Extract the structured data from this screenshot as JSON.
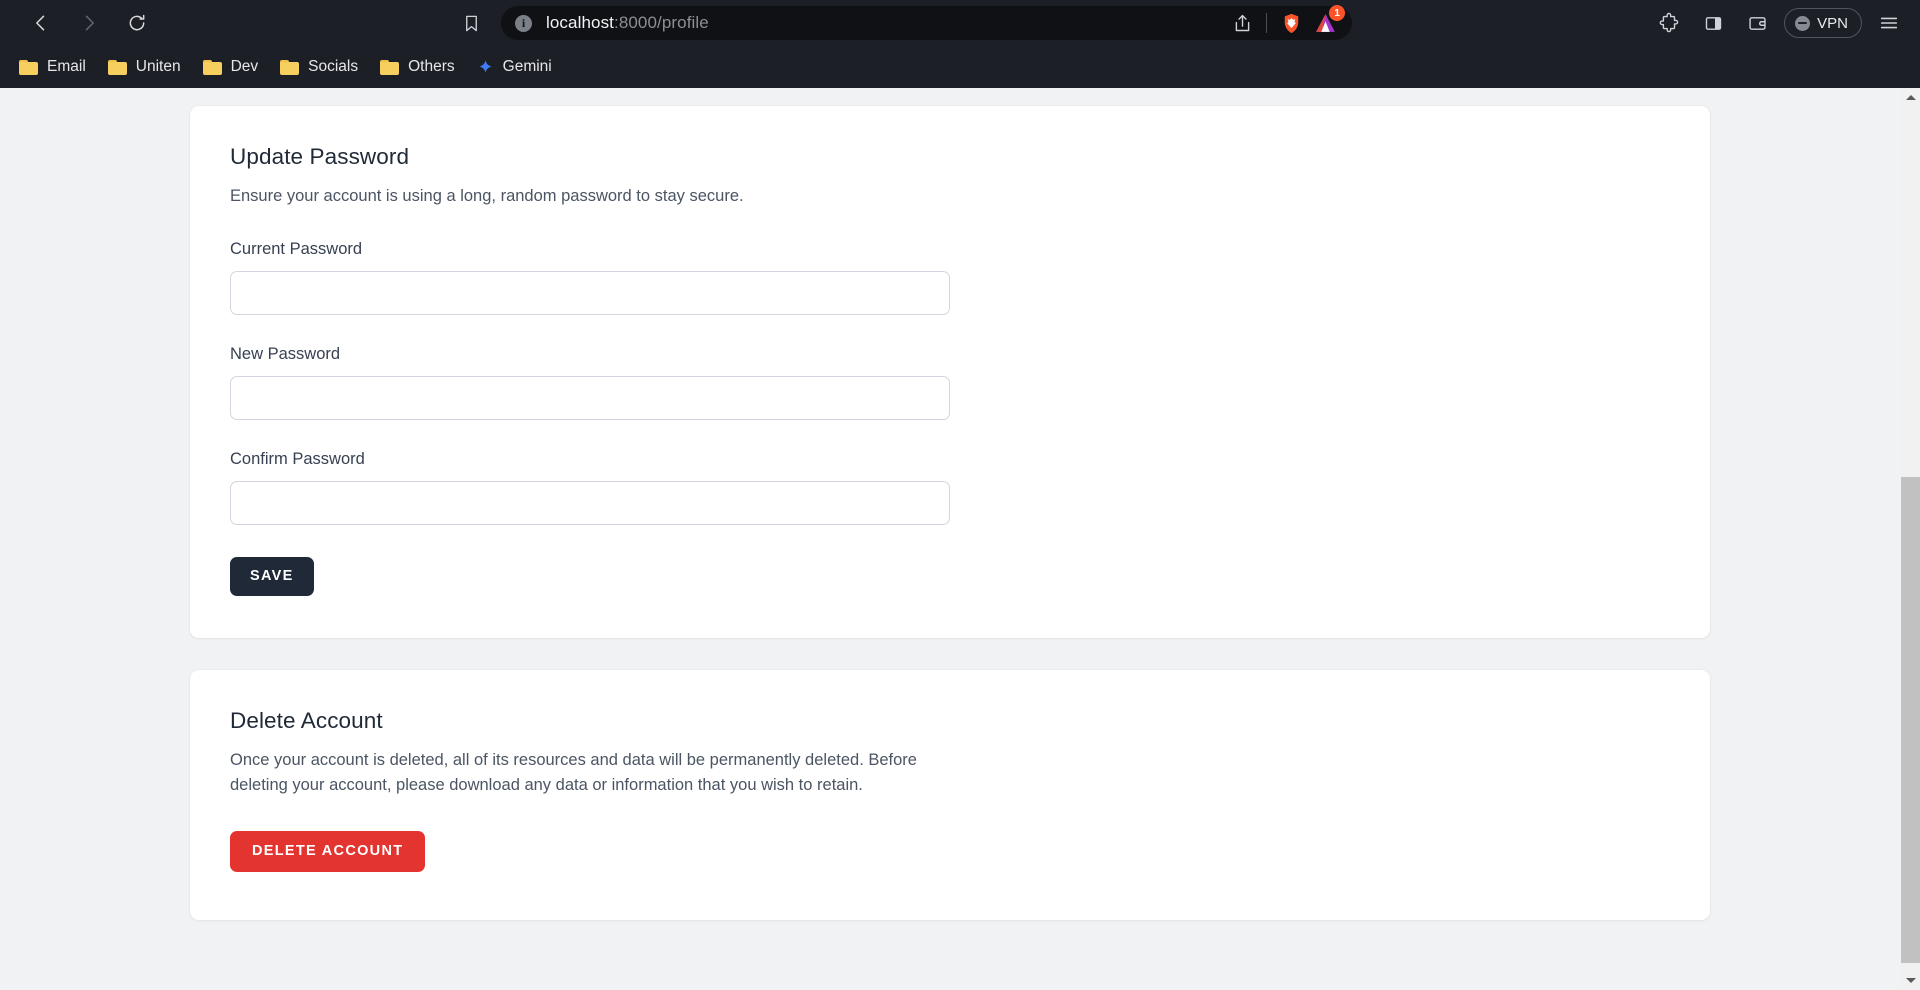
{
  "browser": {
    "nav": {
      "back_label": "Back",
      "forward_label": "Forward",
      "reload_label": "Reload"
    },
    "bookmark_star_label": "Bookmark this page",
    "address_bar": {
      "site_info_glyph": "i",
      "url_host": "localhost",
      "url_rest": ":8000/profile",
      "full_url": "localhost:8000/profile"
    },
    "url_actions": {
      "share_label": "Share",
      "brave_shields_label": "Brave Shields",
      "brave_rewards_label": "Brave Rewards",
      "brave_rewards_count": "1"
    },
    "toolbar_right": {
      "extensions_label": "Extensions",
      "sidebar_label": "Sidebar",
      "wallet_label": "Brave Wallet",
      "vpn_label": "VPN",
      "menu_label": "Customize and control Brave"
    },
    "bookmarks": [
      {
        "label": "Email",
        "icon": "folder-icon"
      },
      {
        "label": "Uniten",
        "icon": "folder-icon"
      },
      {
        "label": "Dev",
        "icon": "folder-icon"
      },
      {
        "label": "Socials",
        "icon": "folder-icon"
      },
      {
        "label": "Others",
        "icon": "folder-icon"
      },
      {
        "label": "Gemini",
        "icon": "sparkle-icon"
      }
    ]
  },
  "page": {
    "update_password": {
      "title": "Update Password",
      "subtitle": "Ensure your account is using a long, random password to stay secure.",
      "fields": [
        {
          "label": "Current Password",
          "value": "",
          "placeholder": ""
        },
        {
          "label": "New Password",
          "value": "",
          "placeholder": ""
        },
        {
          "label": "Confirm Password",
          "value": "",
          "placeholder": ""
        }
      ],
      "save_label": "SAVE"
    },
    "delete_account": {
      "title": "Delete Account",
      "description": "Once your account is deleted, all of its resources and data will be permanently deleted. Before deleting your account, please download any data or information that you wish to retain.",
      "delete_label": "DELETE ACCOUNT"
    }
  },
  "scrollbar": {
    "up_label": "Scroll up",
    "down_label": "Scroll down",
    "thumb_label": "Vertical scroll thumb"
  },
  "colors": {
    "chrome_bg": "#1c1f25",
    "urlbar_bg": "#101114",
    "page_bg": "#f1f2f4",
    "card_bg": "#ffffff",
    "save_button": "#1f2937",
    "delete_button": "#e3342f",
    "brave_orange": "#fb542b",
    "folder_yellow": "#f6cf5e",
    "gemini_blue": "#4285f4"
  }
}
